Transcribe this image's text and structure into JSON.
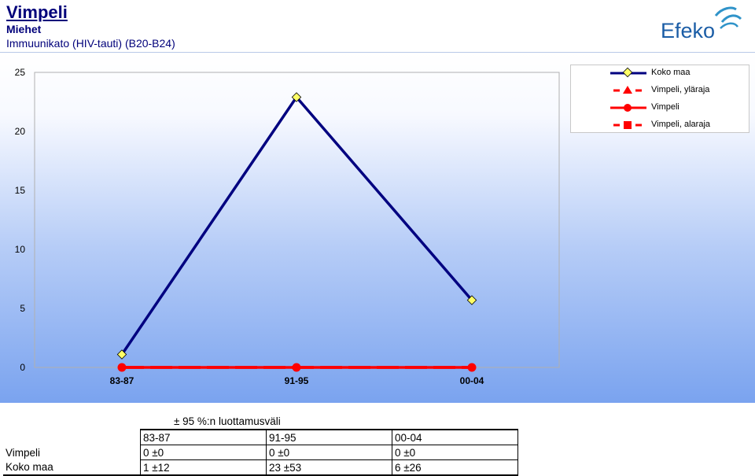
{
  "header": {
    "title": "Vimpeli",
    "subtitle": "Miehet",
    "description": "Immuunikato (HIV-tauti) (B20-B24)"
  },
  "logo": {
    "text": "Efeko"
  },
  "chart_data": {
    "type": "line",
    "categories": [
      "83-87",
      "91-95",
      "00-04"
    ],
    "ylim": [
      0,
      25
    ],
    "yticks": [
      0,
      5,
      10,
      15,
      20,
      25
    ],
    "series": [
      {
        "name": "Koko maa",
        "values": [
          1.1,
          22.9,
          5.7
        ],
        "color": "#000080",
        "marker": "diamond",
        "marker_fill": "#ffff66"
      },
      {
        "name": "Vimpeli, yläraja",
        "values": [
          0,
          0,
          0
        ],
        "color": "#ff0000",
        "marker": "triangle",
        "dashed": true
      },
      {
        "name": "Vimpeli",
        "values": [
          0,
          0,
          0
        ],
        "color": "#ff0000",
        "marker": "circle"
      },
      {
        "name": "Vimpeli, alaraja",
        "values": [
          0,
          0,
          0
        ],
        "color": "#ff0000",
        "marker": "square",
        "dashed": true
      }
    ],
    "legend_position": "top-right"
  },
  "table": {
    "caption": "± 95 %:n luottamusväli",
    "columns": [
      "83-87",
      "91-95",
      "00-04"
    ],
    "rows": [
      {
        "label": "Vimpeli",
        "cells": [
          "0 ±0",
          "0 ±0",
          "0 ±0"
        ]
      },
      {
        "label": "Koko maa",
        "cells": [
          "1 ±12",
          "23 ±53",
          "6 ±26"
        ]
      }
    ]
  }
}
